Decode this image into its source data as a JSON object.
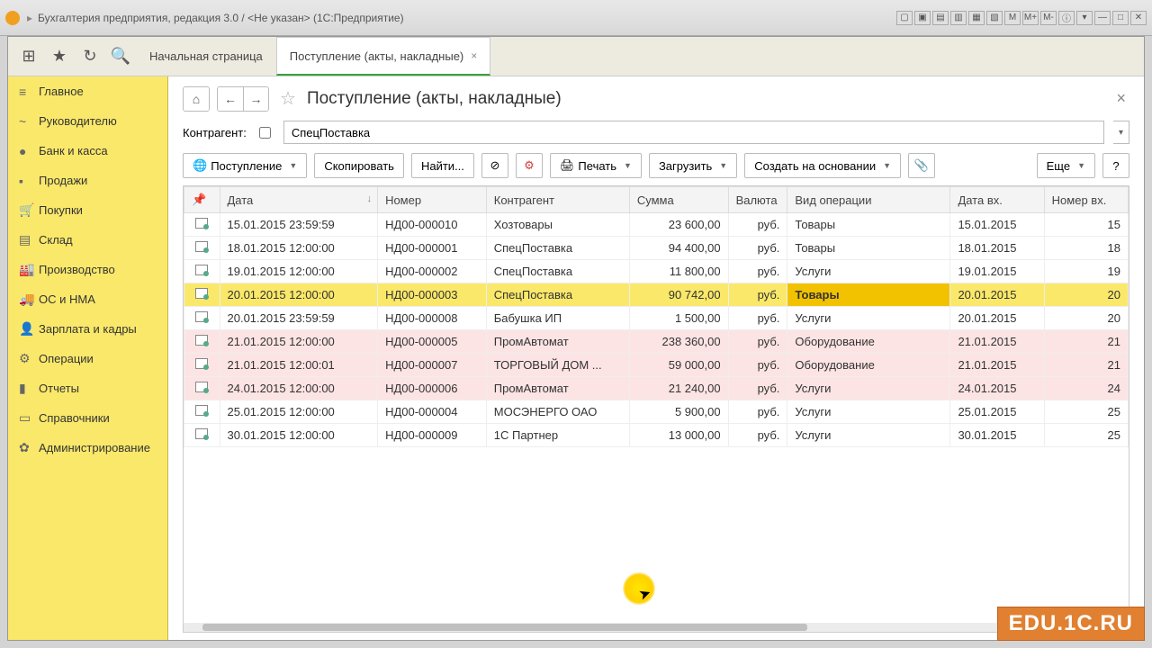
{
  "window": {
    "title": "Бухгалтерия предприятия, редакция 3.0 / <Не указан> (1С:Предприятие)",
    "sys_icons": [
      "M",
      "M+",
      "M-"
    ]
  },
  "tabs": [
    {
      "label": "Начальная страница",
      "active": false
    },
    {
      "label": "Поступление (акты, накладные)",
      "active": true
    }
  ],
  "sidebar": {
    "items": [
      {
        "icon": "≡",
        "label": "Главное"
      },
      {
        "icon": "~",
        "label": "Руководителю"
      },
      {
        "icon": "●",
        "label": "Банк и касса"
      },
      {
        "icon": "▪",
        "label": "Продажи"
      },
      {
        "icon": "🛒",
        "label": "Покупки"
      },
      {
        "icon": "▤",
        "label": "Склад"
      },
      {
        "icon": "🏭",
        "label": "Производство"
      },
      {
        "icon": "🚚",
        "label": "ОС и НМА"
      },
      {
        "icon": "👤",
        "label": "Зарплата и кадры"
      },
      {
        "icon": "⚙",
        "label": "Операции"
      },
      {
        "icon": "▮",
        "label": "Отчеты"
      },
      {
        "icon": "▭",
        "label": "Справочники"
      },
      {
        "icon": "✿",
        "label": "Администрирование"
      }
    ]
  },
  "page": {
    "title": "Поступление (акты, накладные)",
    "filter_label": "Контрагент:",
    "filter_value": "СпецПоставка"
  },
  "toolbar": {
    "receipt": "Поступление",
    "copy": "Скопировать",
    "find": "Найти...",
    "print": "Печать",
    "load": "Загрузить",
    "create_based": "Создать на основании",
    "more": "Еще",
    "help": "?"
  },
  "table": {
    "columns": [
      "",
      "Дата",
      "Номер",
      "Контрагент",
      "Сумма",
      "Валюта",
      "Вид операции",
      "Дата вх.",
      "Номер вх."
    ],
    "rows": [
      {
        "date": "15.01.2015 23:59:59",
        "num": "НД00-000010",
        "agent": "Хозтовары",
        "sum": "23 600,00",
        "cur": "руб.",
        "op": "Товары",
        "date_in": "15.01.2015",
        "num_in": "15",
        "style": ""
      },
      {
        "date": "18.01.2015 12:00:00",
        "num": "НД00-000001",
        "agent": "СпецПоставка",
        "sum": "94 400,00",
        "cur": "руб.",
        "op": "Товары",
        "date_in": "18.01.2015",
        "num_in": "18",
        "style": ""
      },
      {
        "date": "19.01.2015 12:00:00",
        "num": "НД00-000002",
        "agent": "СпецПоставка",
        "sum": "11 800,00",
        "cur": "руб.",
        "op": "Услуги",
        "date_in": "19.01.2015",
        "num_in": "19",
        "style": ""
      },
      {
        "date": "20.01.2015 12:00:00",
        "num": "НД00-000003",
        "agent": "СпецПоставка",
        "sum": "90 742,00",
        "cur": "руб.",
        "op": "Товары",
        "date_in": "20.01.2015",
        "num_in": "20",
        "style": "highlight"
      },
      {
        "date": "20.01.2015 23:59:59",
        "num": "НД00-000008",
        "agent": "Бабушка ИП",
        "sum": "1 500,00",
        "cur": "руб.",
        "op": "Услуги",
        "date_in": "20.01.2015",
        "num_in": "20",
        "style": ""
      },
      {
        "date": "21.01.2015 12:00:00",
        "num": "НД00-000005",
        "agent": "ПромАвтомат",
        "sum": "238 360,00",
        "cur": "руб.",
        "op": "Оборудование",
        "date_in": "21.01.2015",
        "num_in": "21",
        "style": "soft-pink"
      },
      {
        "date": "21.01.2015 12:00:01",
        "num": "НД00-000007",
        "agent": "ТОРГОВЫЙ ДОМ ...",
        "sum": "59 000,00",
        "cur": "руб.",
        "op": "Оборудование",
        "date_in": "21.01.2015",
        "num_in": "21",
        "style": "soft-pink"
      },
      {
        "date": "24.01.2015 12:00:00",
        "num": "НД00-000006",
        "agent": "ПромАвтомат",
        "sum": "21 240,00",
        "cur": "руб.",
        "op": "Услуги",
        "date_in": "24.01.2015",
        "num_in": "24",
        "style": "soft-pink"
      },
      {
        "date": "25.01.2015 12:00:00",
        "num": "НД00-000004",
        "agent": "МОСЭНЕРГО ОАО",
        "sum": "5 900,00",
        "cur": "руб.",
        "op": "Услуги",
        "date_in": "25.01.2015",
        "num_in": "25",
        "style": ""
      },
      {
        "date": "30.01.2015 12:00:00",
        "num": "НД00-000009",
        "agent": "1С Партнер",
        "sum": "13 000,00",
        "cur": "руб.",
        "op": "Услуги",
        "date_in": "30.01.2015",
        "num_in": "25",
        "style": ""
      }
    ]
  },
  "watermark": "EDU.1C.RU"
}
